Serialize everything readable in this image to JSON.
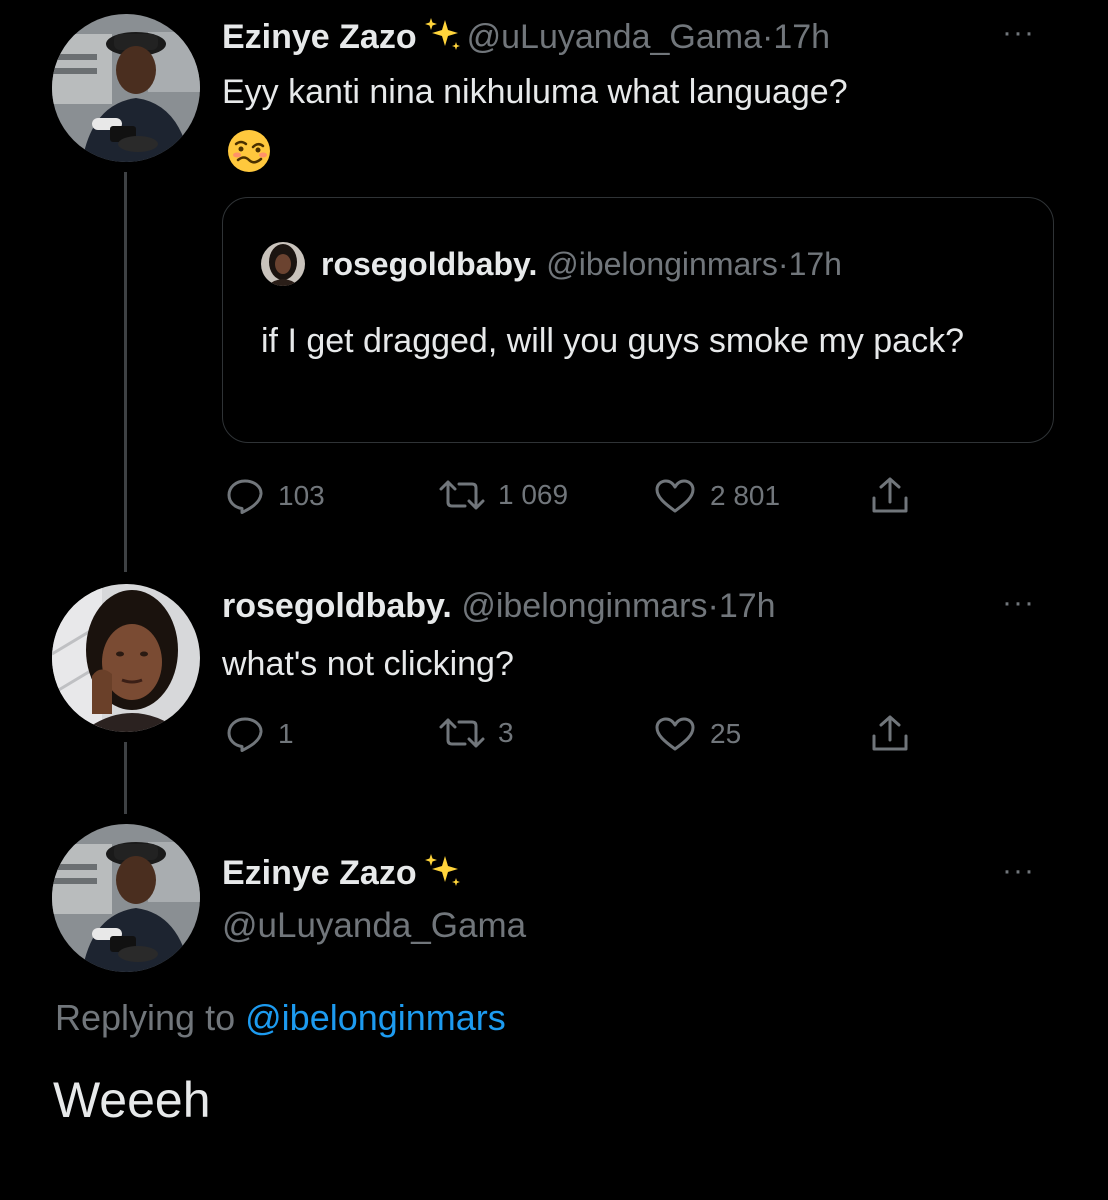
{
  "tweet1": {
    "name": "Ezinye Zazo",
    "handle": "@uLuyanda_Gama",
    "dot": "·",
    "time": "17h",
    "more": "···",
    "text_line1": "Eyy kanti nina nikhuluma what language?",
    "emoji_name": "woozy-face",
    "quote": {
      "name": "rosegoldbaby.",
      "handle": "@ibelonginmars",
      "dot": "·",
      "time": "17h",
      "text": "if I get dragged, will you guys smoke my pack?"
    },
    "actions": {
      "replies": "103",
      "retweets": "1 069",
      "likes": "2 801"
    }
  },
  "tweet2": {
    "name": "rosegoldbaby.",
    "handle": "@ibelonginmars",
    "dot": "·",
    "time": "17h",
    "more": "···",
    "text": "what's not clicking?",
    "actions": {
      "replies": "1",
      "retweets": "3",
      "likes": "25"
    }
  },
  "tweet3": {
    "name": "Ezinye Zazo",
    "handle": "@uLuyanda_Gama",
    "more": "···",
    "replying_prefix": "Replying to",
    "replying_mention": "@ibelonginmars",
    "text": "Weeeh"
  },
  "colors": {
    "background": "#000000",
    "text_primary": "#e7e9ea",
    "text_secondary": "#71767b",
    "accent": "#1d9bf0",
    "border": "#2f3336",
    "sparkle": "#ffd43b"
  },
  "icons": [
    "sparkles-icon",
    "reply-icon",
    "retweet-icon",
    "like-icon",
    "share-icon",
    "more-icon"
  ]
}
